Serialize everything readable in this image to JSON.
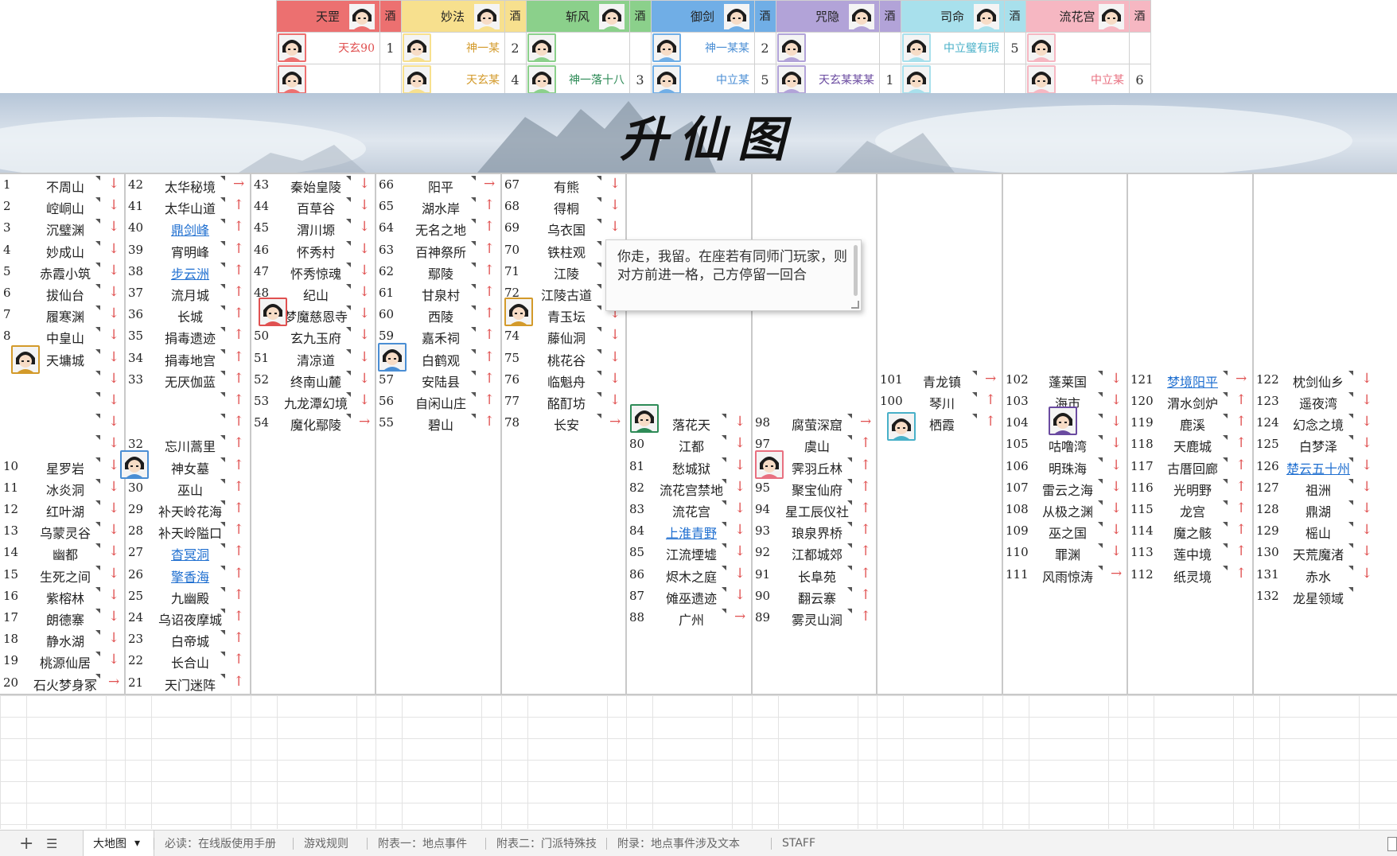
{
  "header": {
    "sects": [
      {
        "name": "天罡",
        "color": "#ec7070",
        "wine": "酒"
      },
      {
        "name": "妙法",
        "color": "#f7e08e",
        "wine": "酒"
      },
      {
        "name": "斩风",
        "color": "#8bd08b",
        "wine": "酒"
      },
      {
        "name": "御剑",
        "color": "#70aee6",
        "wine": "酒"
      },
      {
        "name": "咒隐",
        "color": "#b2a3d8",
        "wine": "酒"
      },
      {
        "name": "司命",
        "color": "#a8e0ec",
        "wine": "酒"
      },
      {
        "name": "流花宫",
        "color": "#f6b7c2",
        "wine": "酒"
      }
    ],
    "row1": [
      {
        "player": "天玄90",
        "color": "#e05050",
        "num": "1"
      },
      {
        "player": "神一某",
        "color": "#d39a2a",
        "num": "2"
      },
      {
        "player": "",
        "color": "#2e8b57",
        "num": ""
      },
      {
        "player": "神一某某",
        "color": "#4a8ed4",
        "num": "2"
      },
      {
        "player": "",
        "color": "#6a4aa0",
        "num": ""
      },
      {
        "player": "中立璧有瑕",
        "color": "#48b0c8",
        "num": "5"
      },
      {
        "player": "",
        "color": "#e05050",
        "num": ""
      }
    ],
    "row2": [
      {
        "player": "",
        "color": "#e05050",
        "num": ""
      },
      {
        "player": "天玄某",
        "color": "#d39a2a",
        "num": "4"
      },
      {
        "player": "神一落十八",
        "color": "#2e8b57",
        "num": "3"
      },
      {
        "player": "中立某",
        "color": "#4a8ed4",
        "num": "5"
      },
      {
        "player": "天玄某某某",
        "color": "#6a4aa0",
        "num": "1"
      },
      {
        "player": "",
        "color": "#48b0c8",
        "num": ""
      },
      {
        "player": "中立某",
        "color": "#e87080",
        "num": "6"
      }
    ]
  },
  "banner": {
    "title": "升仙图"
  },
  "board": {
    "columns": [
      {
        "cells": [
          {
            "n": "1",
            "name": "不周山",
            "arr": "↓"
          },
          {
            "n": "2",
            "name": "崆峒山",
            "arr": "↓"
          },
          {
            "n": "3",
            "name": "沉璧渊",
            "arr": "↓"
          },
          {
            "n": "4",
            "name": "妙成山",
            "arr": "↓"
          },
          {
            "n": "5",
            "name": "赤霞小筑",
            "arr": "↓"
          },
          {
            "n": "6",
            "name": "拔仙台",
            "arr": "↓"
          },
          {
            "n": "7",
            "name": "履寒渊",
            "arr": "↓"
          },
          {
            "n": "8",
            "name": "中皇山",
            "arr": "↓"
          },
          {
            "n": "",
            "name": "天墉城",
            "arr": "↓"
          },
          {
            "n": "",
            "name": "",
            "arr": "↓"
          },
          {
            "n": "",
            "name": "",
            "arr": "↓"
          },
          {
            "n": "",
            "name": "",
            "arr": "↓"
          },
          {
            "n": "",
            "name": "",
            "arr": "↓"
          },
          {
            "n": "10",
            "name": "星罗岩",
            "arr": "↓"
          },
          {
            "n": "11",
            "name": "冰炎洞",
            "arr": "↓"
          },
          {
            "n": "12",
            "name": "红叶湖",
            "arr": "↓"
          },
          {
            "n": "13",
            "name": "乌蒙灵谷",
            "arr": "↓"
          },
          {
            "n": "14",
            "name": "幽都",
            "arr": "↓"
          },
          {
            "n": "15",
            "name": "生死之间",
            "arr": "↓"
          },
          {
            "n": "16",
            "name": "紫榕林",
            "arr": "↓"
          },
          {
            "n": "17",
            "name": "朗德寨",
            "arr": "↓"
          },
          {
            "n": "18",
            "name": "静水湖",
            "arr": "↓"
          },
          {
            "n": "19",
            "name": "桃源仙居",
            "arr": "↓"
          },
          {
            "n": "20",
            "name": "石火梦身冢",
            "arr": "→"
          }
        ]
      },
      {
        "cells": [
          {
            "n": "42",
            "name": "太华秘境",
            "arr": "→"
          },
          {
            "n": "41",
            "name": "太华山道",
            "arr": "↑"
          },
          {
            "n": "40",
            "name": "鼎剑峰",
            "arr": "↑",
            "link": true
          },
          {
            "n": "39",
            "name": "宵明峰",
            "arr": "↑"
          },
          {
            "n": "38",
            "name": "步云洲",
            "arr": "↑",
            "link": true
          },
          {
            "n": "37",
            "name": "流月城",
            "arr": "↑"
          },
          {
            "n": "36",
            "name": "长城",
            "arr": "↑"
          },
          {
            "n": "35",
            "name": "捐毒遗迹",
            "arr": "↑"
          },
          {
            "n": "34",
            "name": "捐毒地宫",
            "arr": "↑"
          },
          {
            "n": "33",
            "name": "无厌伽蓝",
            "arr": "↑"
          },
          {
            "n": "",
            "name": "",
            "arr": "↑"
          },
          {
            "n": "",
            "name": "",
            "arr": "↑"
          },
          {
            "n": "32",
            "name": "忘川蒿里",
            "arr": "↑"
          },
          {
            "n": "",
            "name": "神女墓",
            "arr": "↑"
          },
          {
            "n": "30",
            "name": "巫山",
            "arr": "↑"
          },
          {
            "n": "29",
            "name": "补天岭花海",
            "arr": "↑"
          },
          {
            "n": "28",
            "name": "补天岭隘口",
            "arr": "↑"
          },
          {
            "n": "27",
            "name": "杳冥洞",
            "arr": "↑",
            "link": true
          },
          {
            "n": "26",
            "name": "擎香海",
            "arr": "↑",
            "link": true
          },
          {
            "n": "25",
            "name": "九幽殿",
            "arr": "↑"
          },
          {
            "n": "24",
            "name": "乌诏夜摩城",
            "arr": "↑"
          },
          {
            "n": "23",
            "name": "白帝城",
            "arr": "↑"
          },
          {
            "n": "22",
            "name": "长合山",
            "arr": "↑"
          },
          {
            "n": "21",
            "name": "天门迷阵",
            "arr": "↑"
          }
        ]
      },
      {
        "cells": [
          {
            "n": "43",
            "name": "秦始皇陵",
            "arr": "↓"
          },
          {
            "n": "44",
            "name": "百草谷",
            "arr": "↓"
          },
          {
            "n": "45",
            "name": "渭川塬",
            "arr": "↓"
          },
          {
            "n": "46",
            "name": "怀秀村",
            "arr": "↓"
          },
          {
            "n": "47",
            "name": "怀秀惊魂",
            "arr": "↓"
          },
          {
            "n": "48",
            "name": "纪山",
            "arr": "↓"
          },
          {
            "n": "",
            "name": "梦魔慈恩寺",
            "arr": "↓"
          },
          {
            "n": "50",
            "name": "玄九玉府",
            "arr": "↓"
          },
          {
            "n": "51",
            "name": "清凉道",
            "arr": "↓"
          },
          {
            "n": "52",
            "name": "终南山麓",
            "arr": "↓"
          },
          {
            "n": "53",
            "name": "九龙潭幻境",
            "arr": "↓"
          },
          {
            "n": "54",
            "name": "魔化鄢陵",
            "arr": "→"
          }
        ]
      },
      {
        "cells": [
          {
            "n": "66",
            "name": "阳平",
            "arr": "→"
          },
          {
            "n": "65",
            "name": "湖水岸",
            "arr": "↑"
          },
          {
            "n": "64",
            "name": "无名之地",
            "arr": "↑"
          },
          {
            "n": "63",
            "name": "百神祭所",
            "arr": "↑"
          },
          {
            "n": "62",
            "name": "鄢陵",
            "arr": "↑"
          },
          {
            "n": "61",
            "name": "甘泉村",
            "arr": "↑"
          },
          {
            "n": "60",
            "name": "西陵",
            "arr": "↑"
          },
          {
            "n": "59",
            "name": "嘉禾祠",
            "arr": "↑"
          },
          {
            "n": "",
            "name": "白鹤观",
            "arr": "↑"
          },
          {
            "n": "57",
            "name": "安陆县",
            "arr": "↑"
          },
          {
            "n": "56",
            "name": "自闲山庄",
            "arr": "↑"
          },
          {
            "n": "55",
            "name": "碧山",
            "arr": "↑"
          }
        ]
      },
      {
        "cells": [
          {
            "n": "67",
            "name": "有熊",
            "arr": "↓"
          },
          {
            "n": "68",
            "name": "得桐",
            "arr": "↓"
          },
          {
            "n": "69",
            "name": "乌衣国",
            "arr": "↓"
          },
          {
            "n": "70",
            "name": "铁柱观",
            "arr": "↓"
          },
          {
            "n": "71",
            "name": "江陵",
            "arr": "↓"
          },
          {
            "n": "72",
            "name": "江陵古道",
            "arr": "↓"
          },
          {
            "n": "",
            "name": "青玉坛",
            "arr": "↓"
          },
          {
            "n": "74",
            "name": "藤仙洞",
            "arr": "↓"
          },
          {
            "n": "75",
            "name": "桃花谷",
            "arr": "↓"
          },
          {
            "n": "76",
            "name": "临魁舟",
            "arr": "↓"
          },
          {
            "n": "77",
            "name": "酩酊坊",
            "arr": "↓"
          },
          {
            "n": "78",
            "name": "长安",
            "arr": "→"
          }
        ]
      },
      {
        "cells": [
          {
            "n": "",
            "name": "落花天",
            "arr": "↓"
          },
          {
            "n": "80",
            "name": "江都",
            "arr": "↓"
          },
          {
            "n": "81",
            "name": "愁城狱",
            "arr": "↓"
          },
          {
            "n": "82",
            "name": "流花宫禁地",
            "arr": "↓"
          },
          {
            "n": "83",
            "name": "流花宫",
            "arr": "↓"
          },
          {
            "n": "84",
            "name": "上淮青野",
            "arr": "↓",
            "link": true
          },
          {
            "n": "85",
            "name": "江流堙墟",
            "arr": "↓"
          },
          {
            "n": "86",
            "name": "烬木之庭",
            "arr": "↓"
          },
          {
            "n": "87",
            "name": "傩巫遗迹",
            "arr": "↓"
          },
          {
            "n": "88",
            "name": "广州",
            "arr": "→"
          }
        ]
      },
      {
        "cells": [
          {
            "n": "98",
            "name": "腐萤深窟",
            "arr": "→"
          },
          {
            "n": "97",
            "name": "虞山",
            "arr": "↑"
          },
          {
            "n": "",
            "name": "霁羽丘林",
            "arr": "↑"
          },
          {
            "n": "95",
            "name": "聚宝仙府",
            "arr": "↑"
          },
          {
            "n": "94",
            "name": "星工辰仪社",
            "arr": "↑"
          },
          {
            "n": "93",
            "name": "琅泉界桥",
            "arr": "↑"
          },
          {
            "n": "92",
            "name": "江都城郊",
            "arr": "↑"
          },
          {
            "n": "91",
            "name": "长阜苑",
            "arr": "↑"
          },
          {
            "n": "90",
            "name": "翻云寨",
            "arr": "↑"
          },
          {
            "n": "89",
            "name": "雾灵山涧",
            "arr": "↑"
          }
        ]
      },
      {
        "cells": [
          {
            "n": "101",
            "name": "青龙镇",
            "arr": "→"
          },
          {
            "n": "100",
            "name": "琴川",
            "arr": "↑"
          },
          {
            "n": "",
            "name": "栖霞",
            "arr": "↑"
          }
        ]
      },
      {
        "cells": [
          {
            "n": "102",
            "name": "蓬莱国",
            "arr": "↓"
          },
          {
            "n": "103",
            "name": "海市",
            "arr": "↓"
          },
          {
            "n": "104",
            "name": "",
            "arr": "↓"
          },
          {
            "n": "105",
            "name": "咕噜湾",
            "arr": "↓"
          },
          {
            "n": "106",
            "name": "明珠海",
            "arr": "↓"
          },
          {
            "n": "107",
            "name": "雷云之海",
            "arr": "↓"
          },
          {
            "n": "108",
            "name": "从极之渊",
            "arr": "↓"
          },
          {
            "n": "109",
            "name": "巫之国",
            "arr": "↓"
          },
          {
            "n": "110",
            "name": "罪渊",
            "arr": "↓"
          },
          {
            "n": "111",
            "name": "风雨惊涛",
            "arr": "→"
          }
        ]
      },
      {
        "cells": [
          {
            "n": "121",
            "name": "梦境阳平",
            "arr": "→",
            "link": true
          },
          {
            "n": "120",
            "name": "渭水剑炉",
            "arr": "↑"
          },
          {
            "n": "119",
            "name": "鹿溪",
            "arr": "↑"
          },
          {
            "n": "118",
            "name": "天鹿城",
            "arr": "↑"
          },
          {
            "n": "117",
            "name": "古厝回廊",
            "arr": "↑"
          },
          {
            "n": "116",
            "name": "光明野",
            "arr": "↑"
          },
          {
            "n": "115",
            "name": "龙宫",
            "arr": "↑"
          },
          {
            "n": "114",
            "name": "魔之骸",
            "arr": "↑"
          },
          {
            "n": "113",
            "name": "莲中境",
            "arr": "↑"
          },
          {
            "n": "112",
            "name": "纸灵境",
            "arr": "↑"
          }
        ]
      },
      {
        "cells": [
          {
            "n": "122",
            "name": "枕剑仙乡",
            "arr": "↓"
          },
          {
            "n": "123",
            "name": "遥夜湾",
            "arr": "↓"
          },
          {
            "n": "124",
            "name": "幻念之境",
            "arr": "↓"
          },
          {
            "n": "125",
            "name": "白梦泽",
            "arr": "↓"
          },
          {
            "n": "126",
            "name": "楚云五十州",
            "arr": "↓",
            "link": true
          },
          {
            "n": "127",
            "name": "祖洲",
            "arr": "↓"
          },
          {
            "n": "128",
            "name": "鼎湖",
            "arr": "↓"
          },
          {
            "n": "129",
            "name": "榣山",
            "arr": "↓"
          },
          {
            "n": "130",
            "name": "天荒魔渚",
            "arr": "↓"
          },
          {
            "n": "131",
            "name": "赤水",
            "arr": "↓"
          },
          {
            "n": "132",
            "name": "龙星领域",
            "arr": ""
          }
        ]
      }
    ]
  },
  "tooltip": {
    "text": "你走，我留。在座若有同师门玩家，则对方前进一格，己方停留一回合"
  },
  "tabs": {
    "add": "+",
    "list": "☰",
    "items": [
      "大地图",
      "必读：在线版使用手册",
      "游戏规则",
      "附表一：地点事件",
      "附表二：门派特殊技",
      "附录：地点事件涉及文本",
      "STAFF"
    ]
  }
}
